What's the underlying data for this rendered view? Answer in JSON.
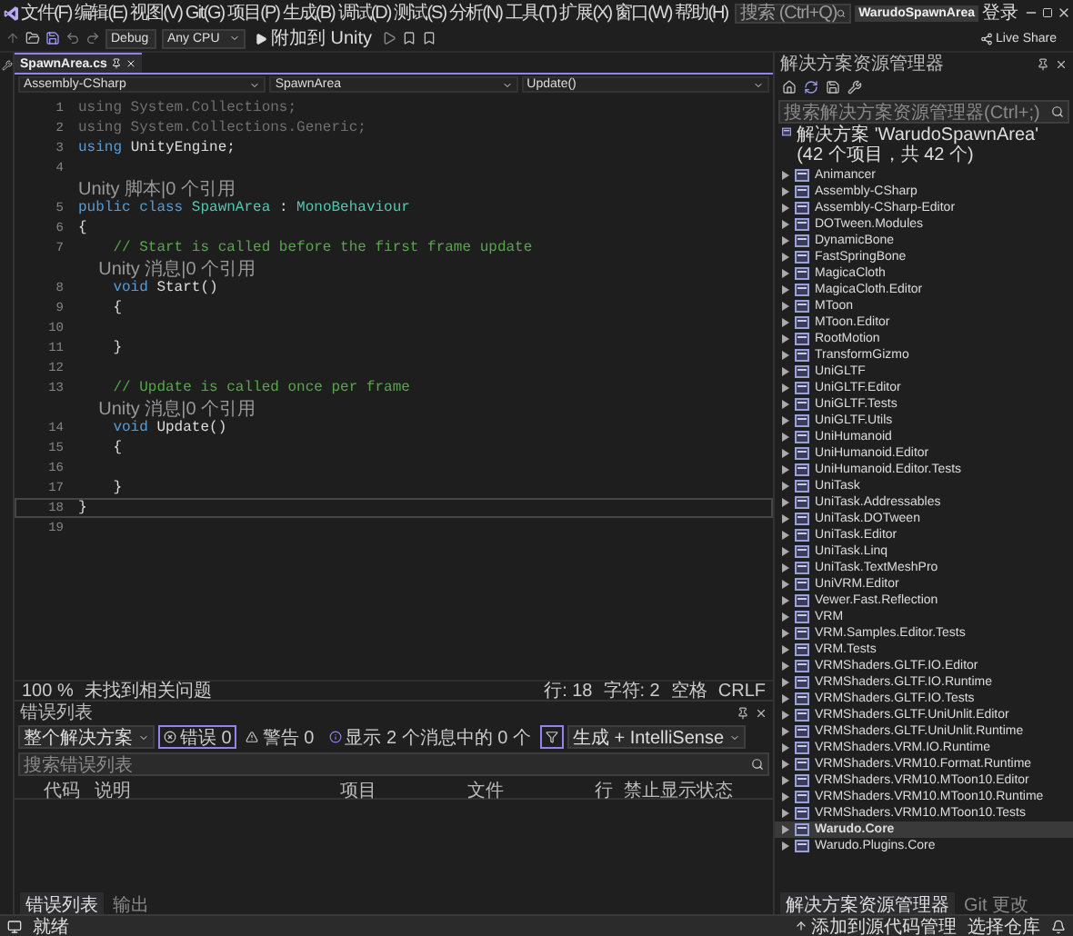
{
  "menu": {
    "items": [
      "文件(F)",
      "编辑(E)",
      "视图(V)",
      "Git(G)",
      "项目(P)",
      "生成(B)",
      "调试(D)",
      "测试(S)",
      "分析(N)",
      "工具(T)",
      "扩展(X)",
      "窗口(W)",
      "帮助(H)"
    ],
    "search": {
      "placeholder": "搜索 (Ctrl+Q)"
    },
    "solution_name": "WarudoSpawnArea",
    "login": "登录"
  },
  "toolbar": {
    "configuration": "Debug",
    "platform": "Any CPU",
    "attach": "附加到 Unity",
    "live_share": "Live Share"
  },
  "editor": {
    "tab": {
      "label": "SpawnArea.cs",
      "selected": true
    },
    "nav": [
      "Assembly-CSharp",
      "SpawnArea",
      "Update()"
    ],
    "lines": [
      {
        "kind": "code",
        "number": "1",
        "current": false,
        "segments": [
          {
            "kind": "dim",
            "text": "using System.Collections;"
          }
        ]
      },
      {
        "kind": "code",
        "number": "2",
        "current": false,
        "segments": [
          {
            "kind": "dim",
            "text": "using System.Collections.Generic;"
          }
        ]
      },
      {
        "kind": "code",
        "number": "3",
        "current": false,
        "segments": [
          {
            "kind": "keyword",
            "text": "using"
          },
          {
            "kind": "plain",
            "text": " UnityEngine;"
          }
        ]
      },
      {
        "kind": "code",
        "number": "4",
        "current": false
      },
      {
        "kind": "lens",
        "text": "Unity 脚本|0 个引用"
      },
      {
        "kind": "code",
        "number": "5",
        "current": false,
        "segments": [
          {
            "kind": "keyword",
            "text": "public class "
          },
          {
            "kind": "type",
            "text": "SpawnArea"
          },
          {
            "kind": "plain",
            "text": " : "
          },
          {
            "kind": "type",
            "text": "MonoBehaviour"
          }
        ]
      },
      {
        "kind": "code",
        "number": "6",
        "current": false,
        "segments": [
          {
            "kind": "plain",
            "text": "{"
          }
        ]
      },
      {
        "kind": "code",
        "number": "7",
        "current": false,
        "segments": [
          {
            "kind": "comment",
            "text": "    // Start is called before the first frame update"
          }
        ]
      },
      {
        "kind": "lens",
        "text": "    Unity 消息|0 个引用"
      },
      {
        "kind": "code",
        "number": "8",
        "current": false,
        "segments": [
          {
            "kind": "keyword",
            "text": "    void"
          },
          {
            "kind": "plain",
            "text": " Start()"
          }
        ]
      },
      {
        "kind": "code",
        "number": "9",
        "current": false,
        "segments": [
          {
            "kind": "plain",
            "text": "    {"
          }
        ]
      },
      {
        "kind": "code",
        "number": "10",
        "current": false
      },
      {
        "kind": "code",
        "number": "11",
        "current": false,
        "segments": [
          {
            "kind": "plain",
            "text": "    }"
          }
        ]
      },
      {
        "kind": "code",
        "number": "12",
        "current": false
      },
      {
        "kind": "code",
        "number": "13",
        "current": false,
        "segments": [
          {
            "kind": "comment",
            "text": "    // Update is called once per frame"
          }
        ]
      },
      {
        "kind": "lens",
        "text": "    Unity 消息|0 个引用"
      },
      {
        "kind": "code",
        "number": "14",
        "current": false,
        "segments": [
          {
            "kind": "keyword",
            "text": "    void"
          },
          {
            "kind": "plain",
            "text": " Update()"
          }
        ]
      },
      {
        "kind": "code",
        "number": "15",
        "current": false,
        "segments": [
          {
            "kind": "plain",
            "text": "    {"
          }
        ]
      },
      {
        "kind": "code",
        "number": "16",
        "current": false
      },
      {
        "kind": "code",
        "number": "17",
        "current": false,
        "segments": [
          {
            "kind": "plain",
            "text": "    }"
          }
        ]
      },
      {
        "kind": "code",
        "number": "18",
        "current": true,
        "segments": [
          {
            "kind": "plain",
            "text": "}"
          }
        ]
      },
      {
        "kind": "code",
        "number": "19",
        "current": false
      }
    ],
    "status": {
      "zoom": "100 %",
      "issues": "未找到相关问题",
      "line": "行: 18",
      "char": "字符: 2",
      "spaces": "空格",
      "eol": "CRLF"
    }
  },
  "error_list": {
    "title": "错误列表",
    "scope": "整个解决方案",
    "errors": "错误 0",
    "warnings": "警告 0",
    "messages": "显示 2 个消息中的 0 个",
    "source": "生成 + IntelliSense",
    "search": {
      "placeholder": "搜索错误列表"
    },
    "columns": [
      "代码",
      "说明",
      "项目",
      "文件",
      "行",
      "禁止显示状态"
    ],
    "tabs": [
      {
        "label": "错误列表",
        "selected": true
      },
      {
        "label": "输出",
        "selected": false
      }
    ]
  },
  "solution_explorer": {
    "title": "解决方案资源管理器",
    "search": {
      "placeholder": "搜索解决方案资源管理器(Ctrl+;)"
    },
    "root": "解决方案 'WarudoSpawnArea' (42 个项目，共 42 个)",
    "projects": [
      {
        "name": "Animancer",
        "selected": false
      },
      {
        "name": "Assembly-CSharp",
        "selected": false
      },
      {
        "name": "Assembly-CSharp-Editor",
        "selected": false
      },
      {
        "name": "DOTween.Modules",
        "selected": false
      },
      {
        "name": "DynamicBone",
        "selected": false
      },
      {
        "name": "FastSpringBone",
        "selected": false
      },
      {
        "name": "MagicaCloth",
        "selected": false
      },
      {
        "name": "MagicaCloth.Editor",
        "selected": false
      },
      {
        "name": "MToon",
        "selected": false
      },
      {
        "name": "MToon.Editor",
        "selected": false
      },
      {
        "name": "RootMotion",
        "selected": false
      },
      {
        "name": "TransformGizmo",
        "selected": false
      },
      {
        "name": "UniGLTF",
        "selected": false
      },
      {
        "name": "UniGLTF.Editor",
        "selected": false
      },
      {
        "name": "UniGLTF.Tests",
        "selected": false
      },
      {
        "name": "UniGLTF.Utils",
        "selected": false
      },
      {
        "name": "UniHumanoid",
        "selected": false
      },
      {
        "name": "UniHumanoid.Editor",
        "selected": false
      },
      {
        "name": "UniHumanoid.Editor.Tests",
        "selected": false
      },
      {
        "name": "UniTask",
        "selected": false
      },
      {
        "name": "UniTask.Addressables",
        "selected": false
      },
      {
        "name": "UniTask.DOTween",
        "selected": false
      },
      {
        "name": "UniTask.Editor",
        "selected": false
      },
      {
        "name": "UniTask.Linq",
        "selected": false
      },
      {
        "name": "UniTask.TextMeshPro",
        "selected": false
      },
      {
        "name": "UniVRM.Editor",
        "selected": false
      },
      {
        "name": "Vewer.Fast.Reflection",
        "selected": false
      },
      {
        "name": "VRM",
        "selected": false
      },
      {
        "name": "VRM.Samples.Editor.Tests",
        "selected": false
      },
      {
        "name": "VRM.Tests",
        "selected": false
      },
      {
        "name": "VRMShaders.GLTF.IO.Editor",
        "selected": false
      },
      {
        "name": "VRMShaders.GLTF.IO.Runtime",
        "selected": false
      },
      {
        "name": "VRMShaders.GLTF.IO.Tests",
        "selected": false
      },
      {
        "name": "VRMShaders.GLTF.UniUnlit.Editor",
        "selected": false
      },
      {
        "name": "VRMShaders.GLTF.UniUnlit.Runtime",
        "selected": false
      },
      {
        "name": "VRMShaders.VRM.IO.Runtime",
        "selected": false
      },
      {
        "name": "VRMShaders.VRM10.Format.Runtime",
        "selected": false
      },
      {
        "name": "VRMShaders.VRM10.MToon10.Editor",
        "selected": false
      },
      {
        "name": "VRMShaders.VRM10.MToon10.Runtime",
        "selected": false
      },
      {
        "name": "VRMShaders.VRM10.MToon10.Tests",
        "selected": false
      },
      {
        "name": "Warudo.Core",
        "selected": true
      },
      {
        "name": "Warudo.Plugins.Core",
        "selected": false
      }
    ],
    "tabs": [
      {
        "label": "解决方案资源管理器",
        "selected": true
      },
      {
        "label": "Git 更改",
        "selected": false
      }
    ]
  },
  "status_bar": {
    "state": "就绪",
    "source_control": "添加到源代码管理",
    "repository": "选择仓库"
  }
}
